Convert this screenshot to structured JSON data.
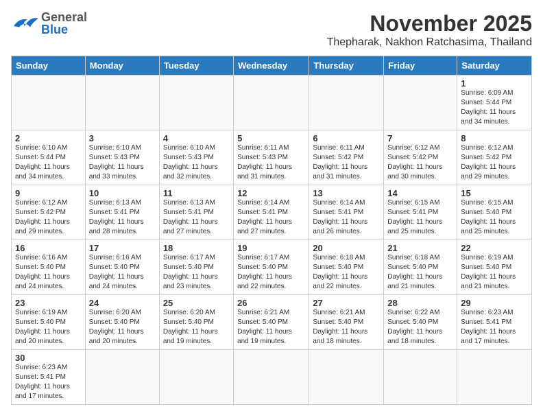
{
  "header": {
    "logo_general": "General",
    "logo_blue": "Blue",
    "month_year": "November 2025",
    "location": "Thepharak, Nakhon Ratchasima, Thailand"
  },
  "days_of_week": [
    "Sunday",
    "Monday",
    "Tuesday",
    "Wednesday",
    "Thursday",
    "Friday",
    "Saturday"
  ],
  "weeks": [
    [
      {
        "day": null,
        "info": null
      },
      {
        "day": null,
        "info": null
      },
      {
        "day": null,
        "info": null
      },
      {
        "day": null,
        "info": null
      },
      {
        "day": null,
        "info": null
      },
      {
        "day": null,
        "info": null
      },
      {
        "day": "1",
        "info": "Sunrise: 6:09 AM\nSunset: 5:44 PM\nDaylight: 11 hours\nand 34 minutes."
      }
    ],
    [
      {
        "day": "2",
        "info": "Sunrise: 6:10 AM\nSunset: 5:44 PM\nDaylight: 11 hours\nand 34 minutes."
      },
      {
        "day": "3",
        "info": "Sunrise: 6:10 AM\nSunset: 5:43 PM\nDaylight: 11 hours\nand 33 minutes."
      },
      {
        "day": "4",
        "info": "Sunrise: 6:10 AM\nSunset: 5:43 PM\nDaylight: 11 hours\nand 32 minutes."
      },
      {
        "day": "5",
        "info": "Sunrise: 6:11 AM\nSunset: 5:43 PM\nDaylight: 11 hours\nand 31 minutes."
      },
      {
        "day": "6",
        "info": "Sunrise: 6:11 AM\nSunset: 5:42 PM\nDaylight: 11 hours\nand 31 minutes."
      },
      {
        "day": "7",
        "info": "Sunrise: 6:12 AM\nSunset: 5:42 PM\nDaylight: 11 hours\nand 30 minutes."
      },
      {
        "day": "8",
        "info": "Sunrise: 6:12 AM\nSunset: 5:42 PM\nDaylight: 11 hours\nand 29 minutes."
      }
    ],
    [
      {
        "day": "9",
        "info": "Sunrise: 6:12 AM\nSunset: 5:42 PM\nDaylight: 11 hours\nand 29 minutes."
      },
      {
        "day": "10",
        "info": "Sunrise: 6:13 AM\nSunset: 5:41 PM\nDaylight: 11 hours\nand 28 minutes."
      },
      {
        "day": "11",
        "info": "Sunrise: 6:13 AM\nSunset: 5:41 PM\nDaylight: 11 hours\nand 27 minutes."
      },
      {
        "day": "12",
        "info": "Sunrise: 6:14 AM\nSunset: 5:41 PM\nDaylight: 11 hours\nand 27 minutes."
      },
      {
        "day": "13",
        "info": "Sunrise: 6:14 AM\nSunset: 5:41 PM\nDaylight: 11 hours\nand 26 minutes."
      },
      {
        "day": "14",
        "info": "Sunrise: 6:15 AM\nSunset: 5:41 PM\nDaylight: 11 hours\nand 25 minutes."
      },
      {
        "day": "15",
        "info": "Sunrise: 6:15 AM\nSunset: 5:40 PM\nDaylight: 11 hours\nand 25 minutes."
      }
    ],
    [
      {
        "day": "16",
        "info": "Sunrise: 6:16 AM\nSunset: 5:40 PM\nDaylight: 11 hours\nand 24 minutes."
      },
      {
        "day": "17",
        "info": "Sunrise: 6:16 AM\nSunset: 5:40 PM\nDaylight: 11 hours\nand 24 minutes."
      },
      {
        "day": "18",
        "info": "Sunrise: 6:17 AM\nSunset: 5:40 PM\nDaylight: 11 hours\nand 23 minutes."
      },
      {
        "day": "19",
        "info": "Sunrise: 6:17 AM\nSunset: 5:40 PM\nDaylight: 11 hours\nand 22 minutes."
      },
      {
        "day": "20",
        "info": "Sunrise: 6:18 AM\nSunset: 5:40 PM\nDaylight: 11 hours\nand 22 minutes."
      },
      {
        "day": "21",
        "info": "Sunrise: 6:18 AM\nSunset: 5:40 PM\nDaylight: 11 hours\nand 21 minutes."
      },
      {
        "day": "22",
        "info": "Sunrise: 6:19 AM\nSunset: 5:40 PM\nDaylight: 11 hours\nand 21 minutes."
      }
    ],
    [
      {
        "day": "23",
        "info": "Sunrise: 6:19 AM\nSunset: 5:40 PM\nDaylight: 11 hours\nand 20 minutes."
      },
      {
        "day": "24",
        "info": "Sunrise: 6:20 AM\nSunset: 5:40 PM\nDaylight: 11 hours\nand 20 minutes."
      },
      {
        "day": "25",
        "info": "Sunrise: 6:20 AM\nSunset: 5:40 PM\nDaylight: 11 hours\nand 19 minutes."
      },
      {
        "day": "26",
        "info": "Sunrise: 6:21 AM\nSunset: 5:40 PM\nDaylight: 11 hours\nand 19 minutes."
      },
      {
        "day": "27",
        "info": "Sunrise: 6:21 AM\nSunset: 5:40 PM\nDaylight: 11 hours\nand 18 minutes."
      },
      {
        "day": "28",
        "info": "Sunrise: 6:22 AM\nSunset: 5:40 PM\nDaylight: 11 hours\nand 18 minutes."
      },
      {
        "day": "29",
        "info": "Sunrise: 6:23 AM\nSunset: 5:41 PM\nDaylight: 11 hours\nand 17 minutes."
      }
    ],
    [
      {
        "day": "30",
        "info": "Sunrise: 6:23 AM\nSunset: 5:41 PM\nDaylight: 11 hours\nand 17 minutes."
      },
      {
        "day": null,
        "info": null
      },
      {
        "day": null,
        "info": null
      },
      {
        "day": null,
        "info": null
      },
      {
        "day": null,
        "info": null
      },
      {
        "day": null,
        "info": null
      },
      {
        "day": null,
        "info": null
      }
    ]
  ]
}
